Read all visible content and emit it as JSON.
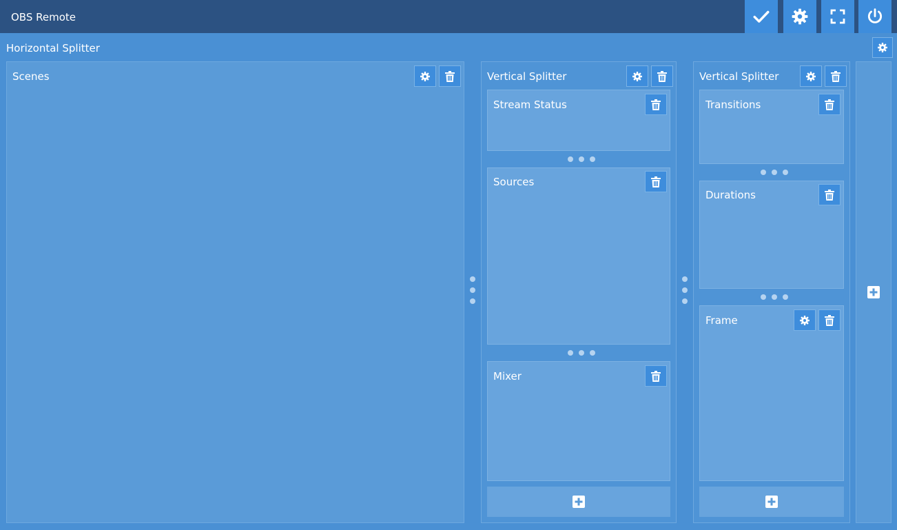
{
  "app": {
    "title": "OBS Remote"
  },
  "toolbar": {
    "buttons": [
      {
        "name": "confirm-button",
        "icon": "check-icon"
      },
      {
        "name": "settings-button",
        "icon": "gear-icon"
      },
      {
        "name": "fullscreen-button",
        "icon": "fullscreen-icon"
      },
      {
        "name": "power-button",
        "icon": "power-icon"
      }
    ]
  },
  "root": {
    "title": "Horizontal Splitter"
  },
  "scenes": {
    "title": "Scenes"
  },
  "vsplit1": {
    "title": "Vertical Splitter",
    "children": [
      {
        "title": "Stream Status"
      },
      {
        "title": "Sources"
      },
      {
        "title": "Mixer"
      }
    ]
  },
  "vsplit2": {
    "title": "Vertical Splitter",
    "children": [
      {
        "title": "Transitions"
      },
      {
        "title": "Durations"
      },
      {
        "title": "Frame"
      }
    ]
  },
  "colors": {
    "topbar": "#2c5282",
    "accent_button": "#3e8ddc",
    "background": "#4a90d4",
    "panel": "#5a9bd8"
  }
}
